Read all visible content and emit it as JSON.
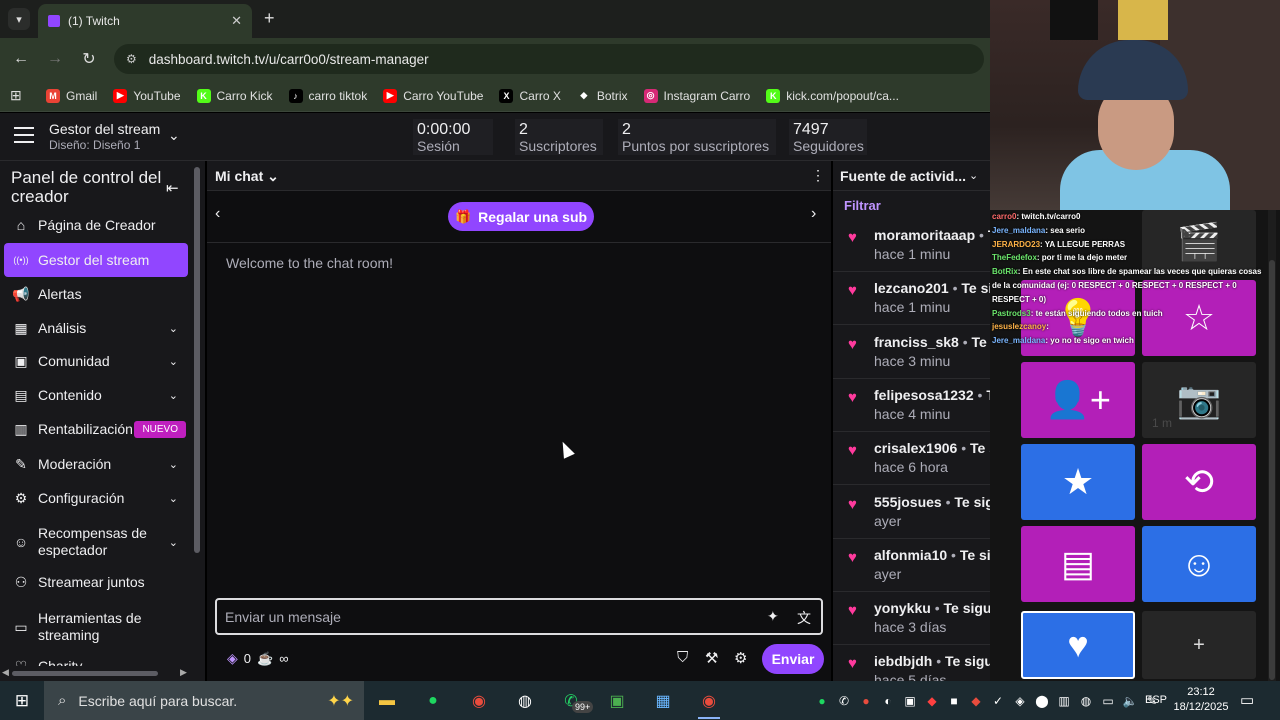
{
  "browser": {
    "tab_title": "(1) Twitch",
    "url": "dashboard.twitch.tv/u/carr0o0/stream-manager",
    "bookmarks": [
      {
        "label": "Gmail",
        "color": "#ea4335",
        "glyph": "M"
      },
      {
        "label": "YouTube",
        "color": "#ff0000",
        "glyph": "▶"
      },
      {
        "label": "Carro Kick",
        "color": "#53fc18",
        "glyph": "K"
      },
      {
        "label": "carro tiktok",
        "color": "#000000",
        "glyph": "♪"
      },
      {
        "label": "Carro YouTube",
        "color": "#ff0000",
        "glyph": "▶"
      },
      {
        "label": "Carro X",
        "color": "#000000",
        "glyph": "X"
      },
      {
        "label": "Botrix",
        "color": "#ffffff",
        "glyph": "◆"
      },
      {
        "label": "Instagram Carro",
        "color": "#d62976",
        "glyph": "◎"
      },
      {
        "label": "kick.com/popout/ca...",
        "color": "#53fc18",
        "glyph": "K"
      }
    ]
  },
  "header": {
    "title": "Gestor del stream",
    "subtitle": "Diseño: Diseño 1",
    "stats": [
      {
        "value": "0:00:00",
        "label": "Sesión"
      },
      {
        "value": "2",
        "label": "Suscriptores"
      },
      {
        "value": "2",
        "label": "Puntos por suscriptores"
      },
      {
        "value": "7497",
        "label": "Seguidores"
      }
    ]
  },
  "nav": {
    "heading": "Panel de control del creador",
    "items": [
      {
        "label": "Página de Creador",
        "icon": "⌂"
      },
      {
        "label": "Gestor del stream",
        "icon": "((•))"
      },
      {
        "label": "Alertas",
        "icon": "📢"
      },
      {
        "label": "Análisis",
        "icon": "▦"
      },
      {
        "label": "Comunidad",
        "icon": "▣"
      },
      {
        "label": "Contenido",
        "icon": "▤"
      },
      {
        "label": "Rentabilización",
        "icon": "▥",
        "badge": "NUEVO"
      },
      {
        "label": "Moderación",
        "icon": "✎"
      },
      {
        "label": "Configuración",
        "icon": "⚙"
      },
      {
        "label": "Recompensas de espectador",
        "icon": "☺"
      },
      {
        "label": "Streamear juntos",
        "icon": "⚇"
      },
      {
        "label": "Herramientas de streaming",
        "icon": "▭"
      },
      {
        "label": "Charity",
        "icon": "♡"
      }
    ]
  },
  "chat": {
    "title": "Mi chat",
    "gift_label": "Regalar una sub",
    "welcome": "Welcome to the chat room!",
    "input_placeholder": "Enviar un mensaje",
    "points": "0",
    "infinity": "∞",
    "send_label": "Enviar"
  },
  "feed": {
    "title": "Fuente de actividad",
    "title_display": "Fuente de activid...",
    "filter_label": "Filtrar",
    "items": [
      {
        "user": "moramoritaaap",
        "action": "Te sigue",
        "time": "hace 1 minu"
      },
      {
        "user": "lezcano201",
        "action": "Te sigue",
        "time": "hace 1 minu"
      },
      {
        "user": "franciss_sk8",
        "action": "Te sigue",
        "time": "hace 3 minu"
      },
      {
        "user": "felipesosa1232",
        "action": "Te sigue",
        "time": "hace 4 minu"
      },
      {
        "user": "crisalex1906",
        "action": "Te sigue",
        "time": "hace 6 hora"
      },
      {
        "user": "555josues",
        "action": "Te sigue",
        "time": "ayer"
      },
      {
        "user": "alfonmia10",
        "action": "Te sigue",
        "time": "ayer"
      },
      {
        "user": "yonykku",
        "action": "Te sigue",
        "time": "hace 3 días"
      },
      {
        "user": "iebdbjdh",
        "action": "Te sigue",
        "time": "hace 5 días"
      }
    ]
  },
  "overlay_chat": [
    {
      "name": "carro0",
      "msg": ": twitch.tv/carro0"
    },
    {
      "name": "Jere_maldana",
      "msg": ": sea serio"
    },
    {
      "name": "JERARDO23",
      "msg": ": YA LLEGUE PERRAS"
    },
    {
      "name": "TheFedefox",
      "msg": ": por ti me la dejo meter"
    },
    {
      "name": "BotRix",
      "msg": ": En este chat sos libre de spamear las veces que quieras cosas de la comunidad (ej: 0 RESPECT + 0 RESPECT + 0 RESPECT + 0 RESPECT + 0)"
    },
    {
      "name": "Pastrods3",
      "msg": ": te están siguiendo todos en tuich"
    },
    {
      "name": "jesuslezcanoy",
      "msg": ":"
    },
    {
      "name": "Jere_maldana",
      "msg": ": yo no te sigo en twich"
    }
  ],
  "quick_actions": {
    "time_label": "1 m",
    "add_label": "+"
  },
  "taskbar": {
    "search_placeholder": "Escribe aquí para buscar.",
    "badge": "99+",
    "lang": "ESP",
    "time": "23:12",
    "date": "18/12/2025"
  },
  "colors": {
    "accent": "#9146ff",
    "heart": "#ff3a9d",
    "magenta_tile": "#b31fb8",
    "blue_tile": "#2c6fe6"
  }
}
